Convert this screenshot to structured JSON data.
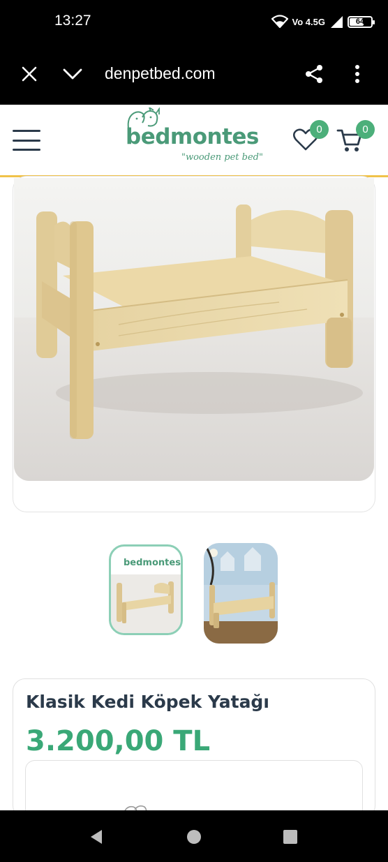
{
  "status_bar": {
    "time": "13:27",
    "network_label": "Vo 4.5G",
    "battery_level": "64",
    "battery_fraction": 0.64,
    "icons": [
      "wifi-icon",
      "signal-icon",
      "battery-icon"
    ]
  },
  "browser": {
    "url": "denpetbed.com",
    "close_icon": "close-icon",
    "collapse_icon": "chevron-down-icon",
    "share_icon": "share-icon",
    "menu_icon": "more-vert-icon"
  },
  "header": {
    "logo_text": "bedmontes",
    "logo_tagline": "\"wooden pet bed\"",
    "wishlist_count": "0",
    "cart_count": "0",
    "brand_color": "#4a9a78",
    "accent_color": "#f0c24a",
    "badge_color": "#4caf7a"
  },
  "product": {
    "title": "Klasik Kedi Köpek Yatağı",
    "price": "3.200,00 TL",
    "price_color": "#3aa877",
    "thumbnail_logo": "bedmontes"
  },
  "nav": {
    "icons": [
      "back-icon",
      "home-icon",
      "recents-icon"
    ]
  }
}
